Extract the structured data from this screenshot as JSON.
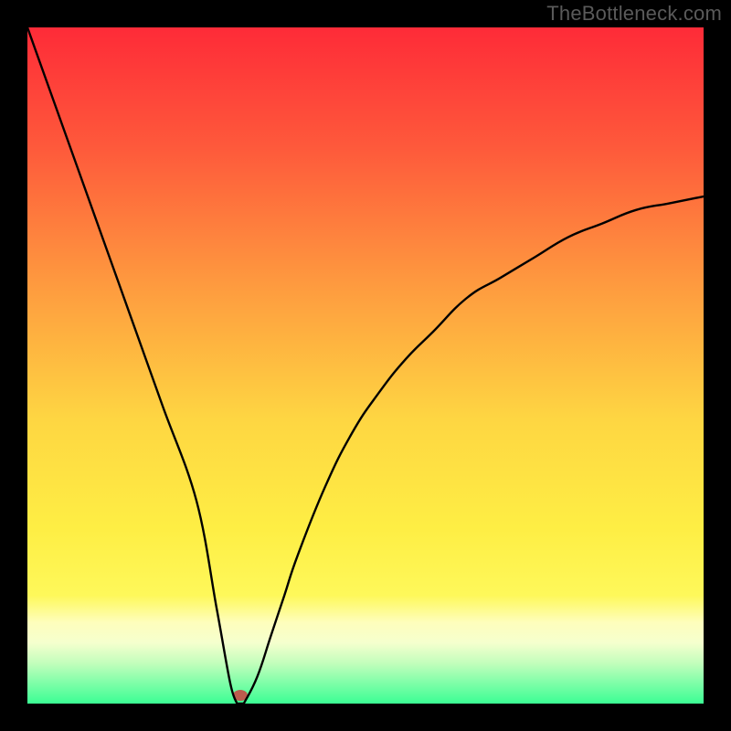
{
  "watermark": "TheBottleneck.com",
  "colors": {
    "top": "#fe2b38",
    "mid1": "#fe8d3e",
    "mid2": "#fee843",
    "band": "#feffc0",
    "band2": "#d7fec0",
    "bottom": "#3bfe94",
    "curve": "#000000",
    "dot": "#bb5c4e",
    "frame": "#000000"
  },
  "chart_data": {
    "type": "line",
    "title": "",
    "xlabel": "",
    "ylabel": "",
    "xlim": [
      0,
      100
    ],
    "ylim": [
      0,
      100
    ],
    "x": [
      0,
      5,
      10,
      15,
      20,
      25,
      28,
      30,
      31,
      32,
      34,
      36,
      38,
      40,
      44,
      48,
      52,
      56,
      60,
      65,
      70,
      75,
      80,
      85,
      90,
      95,
      100
    ],
    "values": [
      100,
      86,
      72,
      58,
      44,
      30,
      14,
      3,
      0,
      0,
      4,
      10,
      16,
      22,
      32,
      40,
      46,
      51,
      55,
      60,
      63,
      66,
      69,
      71,
      73,
      74,
      75
    ],
    "marker": {
      "x": 31.5,
      "y": 0
    },
    "grid": false,
    "legend": false
  }
}
